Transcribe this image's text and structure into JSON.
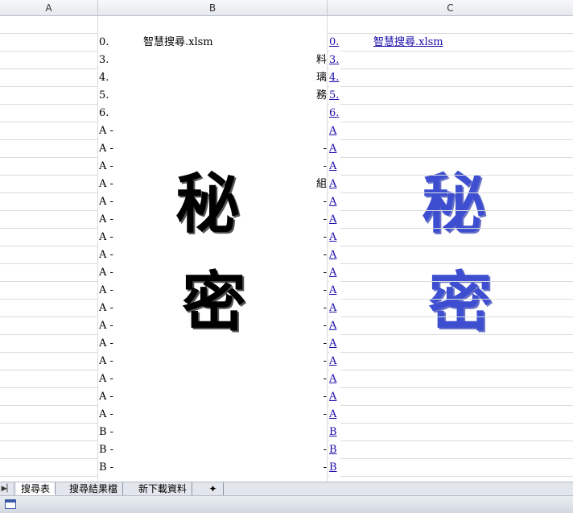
{
  "columns": [
    "A",
    "B",
    "C"
  ],
  "b_column": {
    "file_name": "智慧搜尋.xlsm",
    "left_rows": [
      "0.",
      "3.",
      "4.",
      "5.",
      "6.",
      "A -",
      "A -",
      "A -",
      "A -",
      "A -",
      "A -",
      "A -",
      "A -",
      "A -",
      "A -",
      "A -",
      "A -",
      "A -",
      "A -",
      "A -",
      "A -",
      "A -",
      "B -",
      "B -",
      "B -"
    ],
    "right_rows": [
      "",
      "料",
      "璃",
      "務",
      "",
      "",
      "-",
      "-",
      "組",
      "-",
      "-",
      "-",
      "-",
      "-",
      "-",
      "-",
      "-",
      "-",
      "-",
      "-",
      "-",
      "-",
      "",
      "-",
      "-"
    ],
    "secret_chars": [
      "秘",
      "密"
    ]
  },
  "c_column": {
    "file_link": "智慧搜尋.xlsm",
    "link_rows": [
      "0.",
      "3.",
      "4.",
      "5.",
      "6.",
      "A",
      "A",
      "A",
      "A",
      "A",
      "A",
      "A",
      "A",
      "A",
      "A",
      "A",
      "A",
      "A",
      "A",
      "A",
      "A",
      "A",
      "B",
      "B",
      "B"
    ],
    "secret_chars": [
      "秘",
      "密"
    ]
  },
  "sheet_tabs": [
    "搜尋表",
    "搜尋結果檔",
    "新下載資料"
  ],
  "colors": {
    "link": "#1a0dab",
    "secret_blue": "#3d4fd0"
  },
  "icons": {
    "tab_nav": "tab-nav-arrow-icon",
    "insert_sheet": "insert-sheet-icon",
    "status": "sheet-view-icon"
  }
}
